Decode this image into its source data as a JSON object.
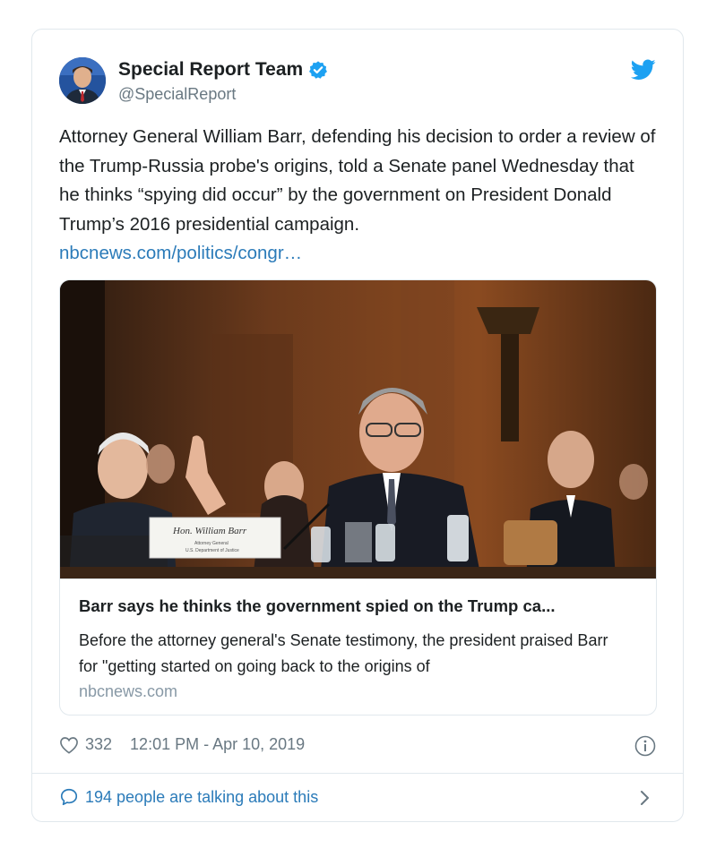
{
  "author": {
    "display_name": "Special Report Team",
    "handle": "@SpecialReport",
    "avatar_icon": "person-avatar-icon",
    "verified_icon": "verified-badge-icon"
  },
  "brand": {
    "icon": "twitter-bird-icon",
    "color": "#1da1f2"
  },
  "tweet": {
    "text": "Attorney General William Barr, defending his decision to order a review of the Trump-Russia probe's origins, told a Senate panel Wednesday that he thinks “spying did occur” by the government on President Donald Trump’s 2016 presidential campaign.",
    "link": "nbcnews.com/politics/congr…"
  },
  "media": {
    "placard_name": "Hon. William Barr",
    "placard_line2": "Attorney General",
    "placard_line3": "U.S. Department of Justice"
  },
  "card": {
    "title": "Barr says he thinks the government spied on the Trump ca...",
    "description": "Before the attorney general's Senate testimony, the president praised Barr for \"getting started on going back to the origins of",
    "domain": "nbcnews.com"
  },
  "meta": {
    "likes": "332",
    "timestamp": "12:01 PM - Apr 10, 2019"
  },
  "footer": {
    "conversation": "194 people are talking about this"
  },
  "colors": {
    "link": "#2b7bb9",
    "muted": "#697882",
    "border": "#e1e8ed",
    "verified": "#1da1f2"
  }
}
